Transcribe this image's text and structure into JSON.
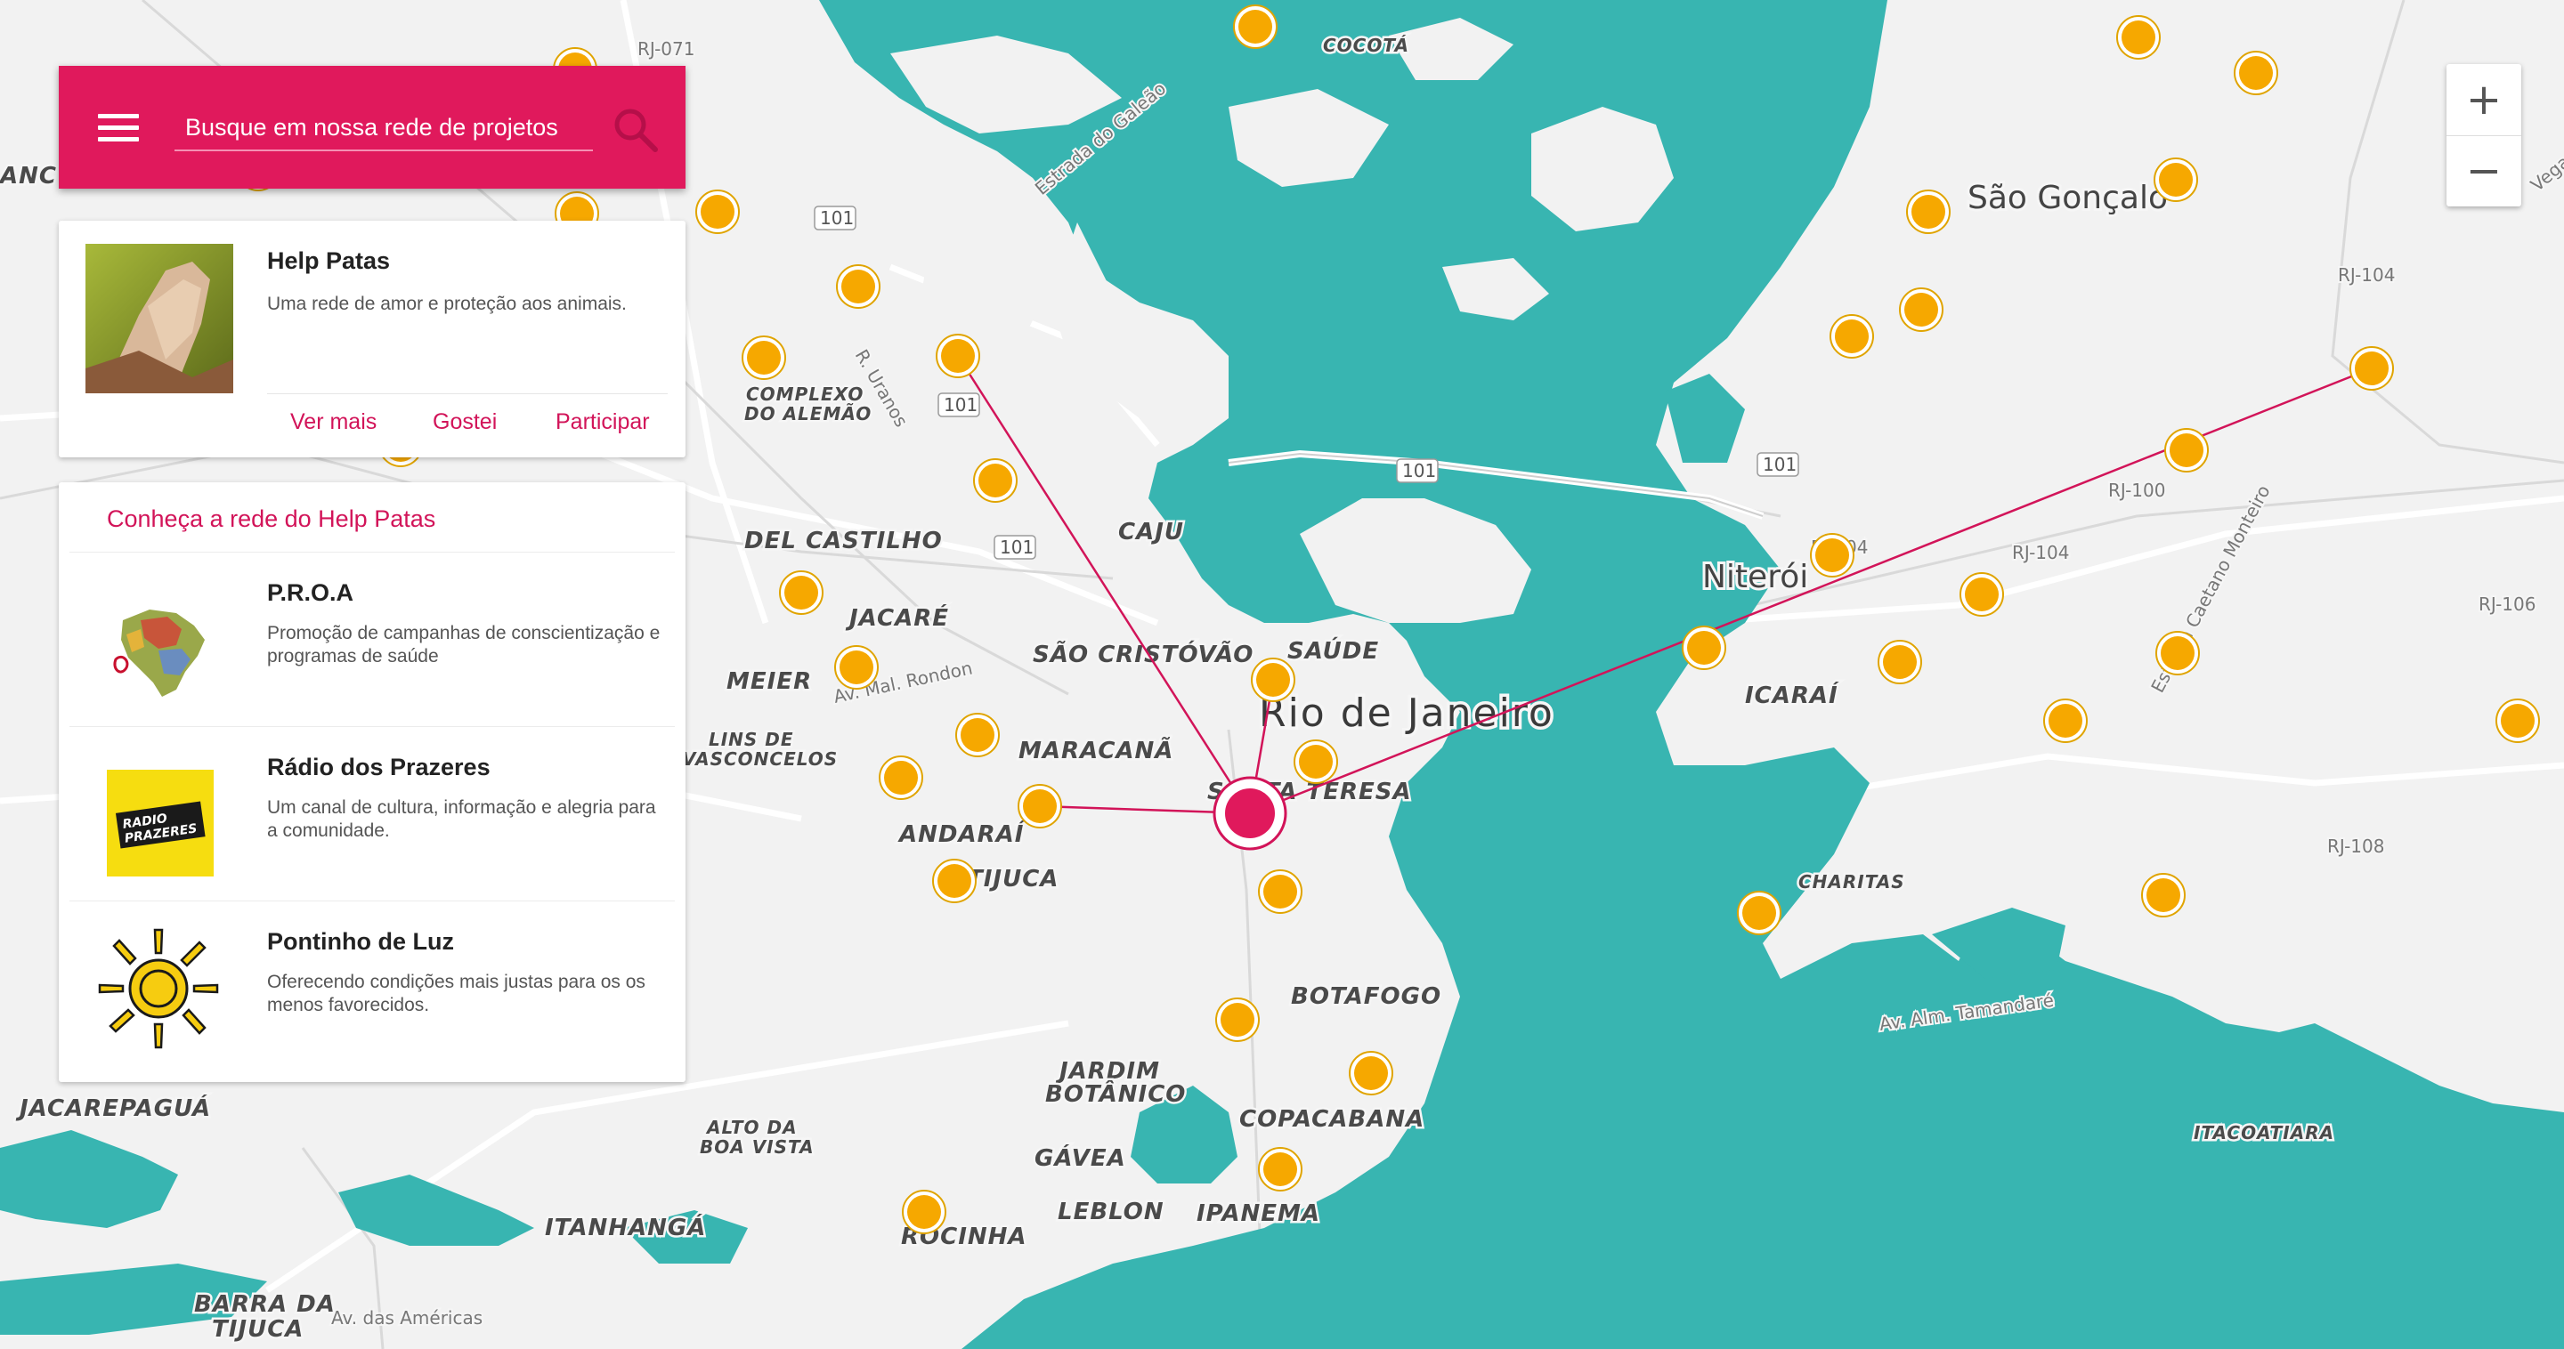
{
  "search": {
    "placeholder": "Busque em nossa rede de projetos"
  },
  "featured": {
    "title": "Help Patas",
    "description": "Uma rede de amor e proteção aos animais.",
    "actions": [
      "Ver mais",
      "Gostei",
      "Participar"
    ]
  },
  "network": {
    "title": "Conheça a rede do Help Patas",
    "items": [
      {
        "title": "P.R.O.A",
        "description": "Promoção de campanhas de conscientização e programas de saúde"
      },
      {
        "title": "Rádio dos Prazeres",
        "description": "Um canal de cultura, informação e alegria para a comunidade.",
        "logo_text": "RADIO PRAZERES"
      },
      {
        "title": "Pontinho de Luz",
        "description": "Oferecendo condições mais justas para os os menos favorecidos."
      }
    ]
  },
  "zoom": {
    "in": "+",
    "out": "−"
  },
  "map": {
    "colors": {
      "water": "#38b5b1",
      "land": "#f2f2f2",
      "accent": "#e0195c",
      "marker": "#f6a800"
    },
    "labels": {
      "cities": [
        "Rio de Janeiro",
        "Niterói",
        "São Gonçalo"
      ],
      "neighborhoods": [
        "COCOTÁ",
        "COMPLEXO DO ALEMÃO",
        "DEL CASTILHO",
        "CAJU",
        "JACARÉ",
        "SÃO CRISTÓVÃO",
        "SAÚDE",
        "MEIER",
        "LINS DE VASCONCELOS",
        "MARACANÃ",
        "SANTA TERESA",
        "ANDARAÍ",
        "TIJUCA",
        "BOTAFOGO",
        "JARDIM BOTÂNICO",
        "COPACABANA",
        "ALTO DA BOA VISTA",
        "GÁVEA",
        "LEBLON",
        "IPANEMA",
        "ROCINHA",
        "ITANHANGÁ",
        "BARRA DA TIJUCA",
        "JACAREPAGUÁ",
        "ICARAÍ",
        "CHARITAS",
        "ITACOATIARA",
        "ANCHIETA"
      ],
      "roads": [
        "RJ-071",
        "Estrada do Galeão",
        "R. Uranos",
        "Av. Mal. Rondon",
        "Av. das Américas",
        "Av. Alm. Tamandaré",
        "Estrada Caetano Monteiro",
        "RJ-104",
        "RJ-100",
        "RJ-106",
        "RJ-108",
        "Vega"
      ],
      "shields": [
        "101"
      ]
    }
  }
}
